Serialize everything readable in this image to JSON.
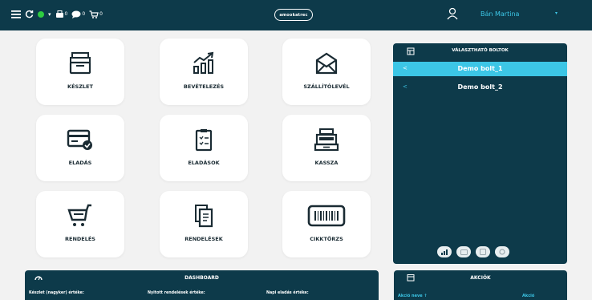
{
  "topbar": {
    "counts": {
      "cart": "0",
      "chat": "0",
      "basket": "0"
    },
    "logo_text": "amookatrec",
    "user_name": "Bán Martina"
  },
  "tiles": [
    {
      "label": "KÉSZLET",
      "icon": "inventory-tray-icon"
    },
    {
      "label": "BEVÉTELEZÉS",
      "icon": "growth-chart-icon"
    },
    {
      "label": "SZÁLLÍTÓLEVÉL",
      "icon": "envelope-icon"
    },
    {
      "label": "ELADÁS",
      "icon": "card-check-icon"
    },
    {
      "label": "ELADÁSOK",
      "icon": "clipboard-list-icon"
    },
    {
      "label": "KASSZA",
      "icon": "cash-register-icon"
    },
    {
      "label": "RENDELÉS",
      "icon": "shopping-cart-icon"
    },
    {
      "label": "RENDELÉSEK",
      "icon": "documents-icon"
    },
    {
      "label": "CIKKTÖRZS",
      "icon": "barcode-icon"
    }
  ],
  "shops": {
    "title": "VÁLASZTHATÓ BOLTOK",
    "items": [
      {
        "name": "Demo bolt_1",
        "active": true
      },
      {
        "name": "Demo bolt_2",
        "active": false
      }
    ]
  },
  "dashboard": {
    "title": "DASHBOARD",
    "labels": [
      "Készlet (nagyker) értéke:",
      "Nyitott rendelések értéke:",
      "Napi eladás értéke:"
    ]
  },
  "akciok": {
    "title": "AKCIÓK",
    "col_left": "Akció neve ↑",
    "col_right": "Akció"
  },
  "colors": {
    "navy": "#0d3a4a",
    "accent": "#3cc6e6",
    "background": "#f2f2f2",
    "online": "#2ecc40"
  }
}
